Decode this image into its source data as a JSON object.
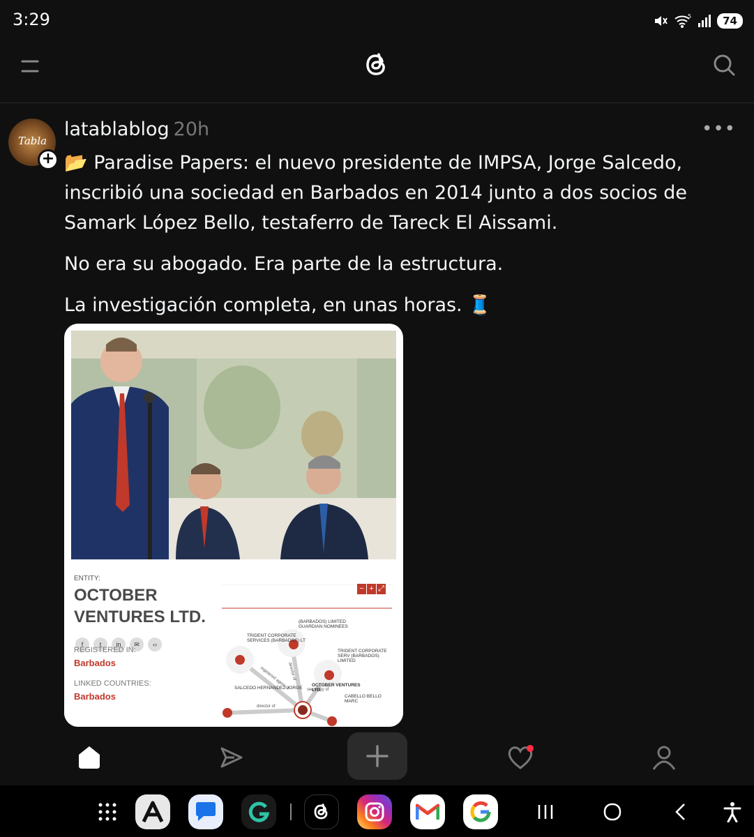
{
  "status": {
    "time": "3:29",
    "battery": "74",
    "icons": [
      "mute-icon",
      "wifi-icon",
      "signal-icon",
      "battery-icon"
    ]
  },
  "appbar": {
    "icons": [
      "menu-icon",
      "threads-logo",
      "search-icon"
    ]
  },
  "post": {
    "username": "latablablog",
    "time": "20h",
    "avatar_text": "Tabla",
    "paragraphs": [
      "📂 Paradise Papers: el nuevo presidente de IMPSA, Jorge Salcedo, inscribió una sociedad en Barbados en 2014 junto a dos socios de Samark López Bello, testaferro de Tareck El Aissami.",
      "No era su abogado. Era parte de la estructura.",
      "La investigación completa, en unas horas. 🧵"
    ],
    "media": {
      "entity_label": "ENTITY:",
      "entity_name": "OCTOBER VENTURES LTD.",
      "registered_label": "REGISTERED IN:",
      "registered_value": "Barbados",
      "linked_label": "LINKED COUNTRIES:",
      "linked_value": "Barbados",
      "graph_controls": [
        "−",
        "+",
        "⤢"
      ],
      "graph_nodes": [
        "(BARBADOS) LIMITED GUARDIAN NOMINEES",
        "TRIDENT CORPORATE SERVICES (BARBADOS) LT",
        "TRIDENT CORPORATE SERV (BARBADOS) LIMITED",
        "OCTOBER VENTURES LTD.",
        "SALCEDO HERNANDEZ JORGE",
        "CABELLO BELLO MARC"
      ],
      "graph_edges": [
        "director of",
        "registered agent of",
        "secretary of",
        "director of"
      ]
    }
  },
  "bottomnav": {
    "items": [
      "home-icon",
      "send-icon",
      "compose-icon",
      "activity-icon",
      "profile-icon"
    ],
    "activity_badge_color": "#ff3040"
  },
  "dock": {
    "apps": [
      "apps-grid-icon",
      "aurora-store-icon",
      "messages-icon",
      "grammarly-icon",
      "threads-icon",
      "instagram-icon",
      "gmail-icon",
      "google-icon"
    ],
    "system": [
      "recents-icon",
      "home-circle-icon",
      "back-icon",
      "accessibility-icon"
    ]
  }
}
